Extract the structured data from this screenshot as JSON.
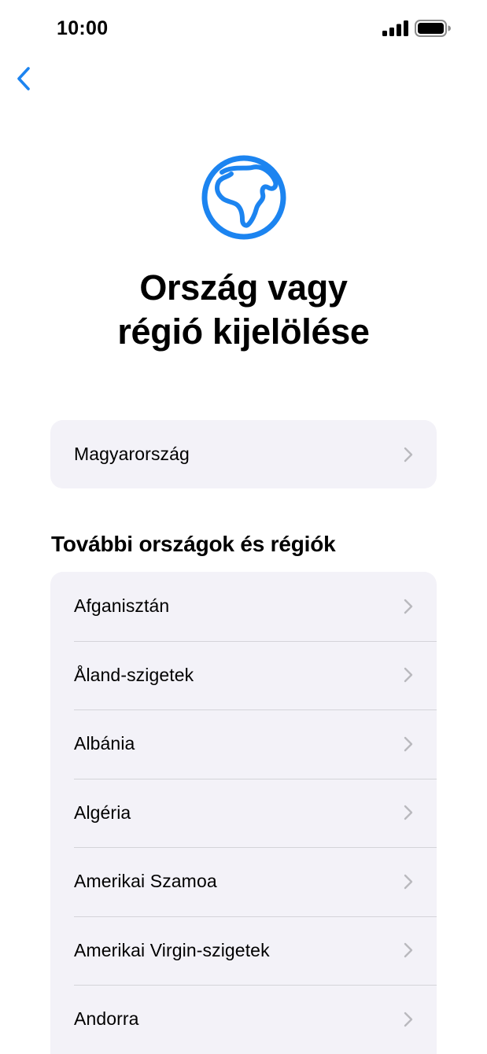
{
  "status_bar": {
    "time": "10:00"
  },
  "nav": {
    "back_icon": "chevron-left-icon"
  },
  "header": {
    "icon": "globe-icon",
    "title_line1": "Ország vagy",
    "title_line2": "régió kijelölése"
  },
  "current_region": {
    "label": "Magyarország"
  },
  "section": {
    "title": "További országok és régiók"
  },
  "regions": [
    {
      "label": "Afganisztán"
    },
    {
      "label": "Åland-szigetek"
    },
    {
      "label": "Albánia"
    },
    {
      "label": "Algéria"
    },
    {
      "label": "Amerikai Szamoa"
    },
    {
      "label": "Amerikai Virgin-szigetek"
    },
    {
      "label": "Andorra"
    }
  ],
  "colors": {
    "accent": "#1c84f0",
    "card_bg": "#f3f2f8",
    "chevron": "#b9b9be",
    "separator": "#d4d4d9"
  }
}
